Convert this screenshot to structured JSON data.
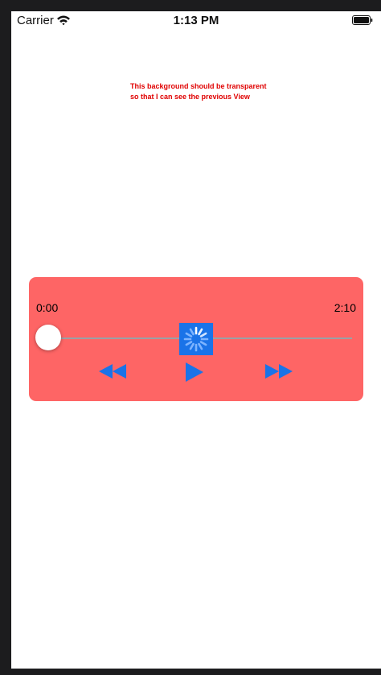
{
  "status_bar": {
    "carrier": "Carrier",
    "time": "1:13 PM",
    "icons": [
      "wifi-icon",
      "battery-icon"
    ]
  },
  "note": {
    "line1": "This background should be transparent",
    "line2": "so that I can see the previous View",
    "color": "#e00000"
  },
  "player": {
    "background_color": "#fe6565",
    "accent_color": "#1a73e8",
    "current_time": "0:00",
    "duration": "2:10",
    "progress": 0,
    "controls": {
      "rewind_icon": "rewind-icon",
      "play_icon": "play-icon",
      "forward_icon": "fast-forward-icon",
      "loading_icon": "loading-spinner-icon"
    }
  }
}
